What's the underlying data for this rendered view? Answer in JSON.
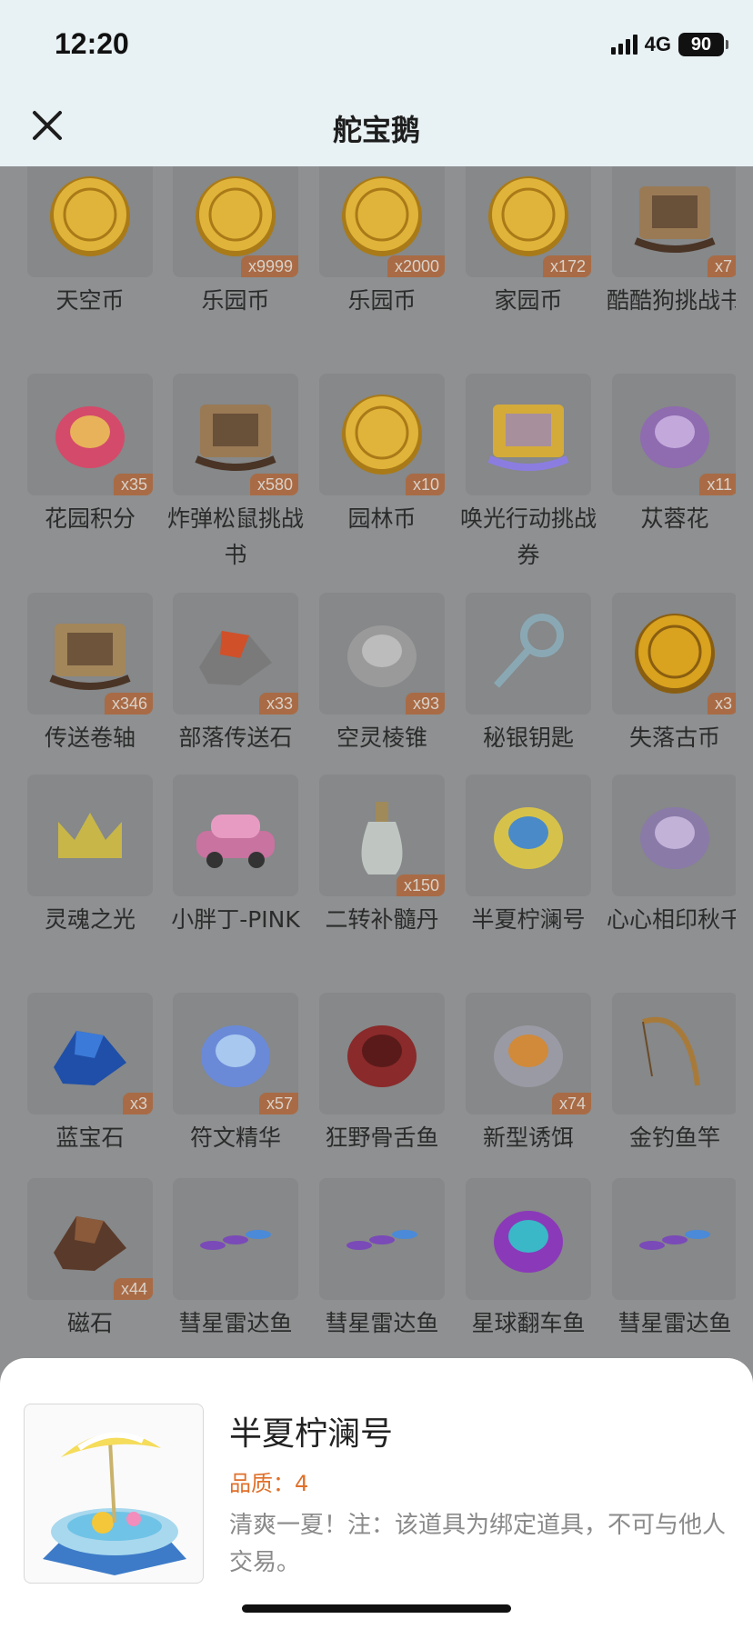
{
  "status_bar": {
    "time": "12:20",
    "network": "4G",
    "battery": "90"
  },
  "header": {
    "title": "舵宝鹅",
    "close_icon": "close-icon"
  },
  "items": [
    {
      "label": "天空币",
      "qty": "",
      "icon": "bow-coin-icon"
    },
    {
      "label": "乐园币",
      "qty": "x9999",
      "icon": "chest-coin-icon"
    },
    {
      "label": "乐园币",
      "qty": "x2000",
      "icon": "chest-coin-icon"
    },
    {
      "label": "家园币",
      "qty": "x172",
      "icon": "home-coin-icon"
    },
    {
      "label": "酷酷狗挑战书",
      "qty": "x7",
      "icon": "wanted-scroll-icon"
    },
    {
      "label": "花园积分",
      "qty": "x35",
      "icon": "flower-icon"
    },
    {
      "label": "炸弹松鼠挑战书",
      "qty": "x580",
      "icon": "wanted-scroll-icon"
    },
    {
      "label": "园林币",
      "qty": "x10",
      "icon": "garden-coin-icon"
    },
    {
      "label": "唤光行动挑战券",
      "qty": "",
      "icon": "ticket-scroll-icon"
    },
    {
      "label": "苁蓉花",
      "qty": "x11",
      "icon": "purple-flower-icon"
    },
    {
      "label": "传送卷轴",
      "qty": "x346",
      "icon": "teleport-scroll-icon"
    },
    {
      "label": "部落传送石",
      "qty": "x33",
      "icon": "tribe-stone-icon"
    },
    {
      "label": "空灵棱锥",
      "qty": "x93",
      "icon": "pyramid-icon"
    },
    {
      "label": "秘银钥匙",
      "qty": "",
      "icon": "key-icon"
    },
    {
      "label": "失落古币",
      "qty": "x3",
      "icon": "ankh-coin-icon"
    },
    {
      "label": "灵魂之光",
      "qty": "",
      "icon": "crown-icon"
    },
    {
      "label": "小胖丁-PINK",
      "qty": "",
      "icon": "pink-car-icon"
    },
    {
      "label": "二转补髓丹",
      "qty": "x150",
      "icon": "bottle-icon"
    },
    {
      "label": "半夏柠澜号",
      "qty": "",
      "icon": "float-pool-icon"
    },
    {
      "label": "心心相印秋千",
      "qty": "",
      "icon": "swing-icon"
    },
    {
      "label": "蓝宝石",
      "qty": "x3",
      "icon": "sapphire-icon"
    },
    {
      "label": "符文精华",
      "qty": "x57",
      "icon": "rune-essence-icon"
    },
    {
      "label": "狂野骨舌鱼",
      "qty": "",
      "icon": "arowana-fish-icon"
    },
    {
      "label": "新型诱饵",
      "qty": "x74",
      "icon": "bait-icon"
    },
    {
      "label": "金钓鱼竿",
      "qty": "",
      "icon": "fishing-rod-icon"
    },
    {
      "label": "磁石",
      "qty": "x44",
      "icon": "magnet-stone-icon"
    },
    {
      "label": "彗星雷达鱼",
      "qty": "",
      "icon": "radar-fish-icon"
    },
    {
      "label": "彗星雷达鱼",
      "qty": "",
      "icon": "radar-fish-icon"
    },
    {
      "label": "星球翻车鱼",
      "qty": "",
      "icon": "sunfish-icon"
    },
    {
      "label": "彗星雷达鱼",
      "qty": "",
      "icon": "radar-fish-icon"
    }
  ],
  "detail": {
    "name": "半夏柠澜号",
    "quality": "品质：4",
    "description": "清爽一夏！注：该道具为绑定道具，不可与他人交易。",
    "icon": "float-pool-icon"
  },
  "colors": {
    "accent_quality": "#e0702a",
    "qty_badge": "#a96b45",
    "header_bg": "#e8f1f3"
  }
}
